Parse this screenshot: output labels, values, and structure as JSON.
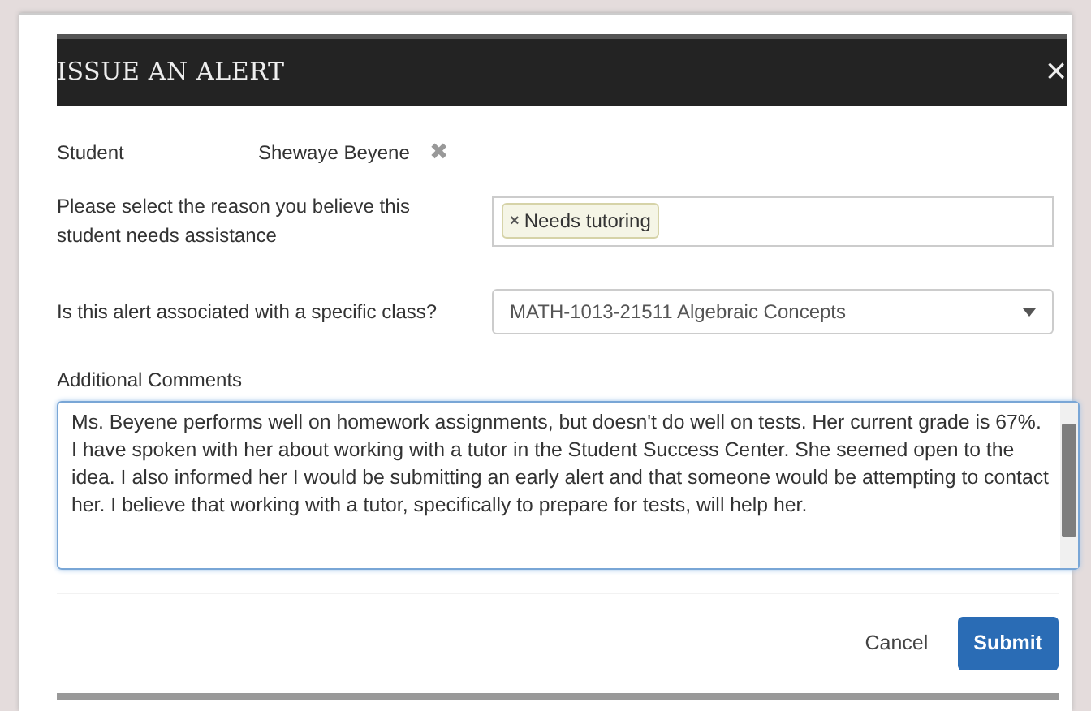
{
  "dialog": {
    "title": "ISSUE AN ALERT",
    "close": "×"
  },
  "student": {
    "label": "Student",
    "name": "Shewaye Beyene",
    "remove": "✖"
  },
  "reason": {
    "label": "Please select the reason you believe this student needs assistance",
    "tags": [
      {
        "remove": "×",
        "label": "Needs tutoring"
      }
    ]
  },
  "class": {
    "label": "Is this alert associated with a specific class?",
    "value": "MATH-1013-21511 Algebraic Concepts"
  },
  "comments": {
    "label": "Additional Comments",
    "value": "Ms. Beyene performs well on homework assignments, but doesn't do well on tests. Her current grade is 67%. I have spoken with her about working with a tutor in the Student Success Center. She seemed open to the idea. I also informed her I would be submitting an early alert and that someone would be attempting to contact her. I believe that working with a tutor, specifically to prepare for tests, will help her."
  },
  "buttons": [
    {
      "kind": "link",
      "label": "Cancel"
    },
    {
      "kind": "primary",
      "label": "Submit"
    }
  ]
}
